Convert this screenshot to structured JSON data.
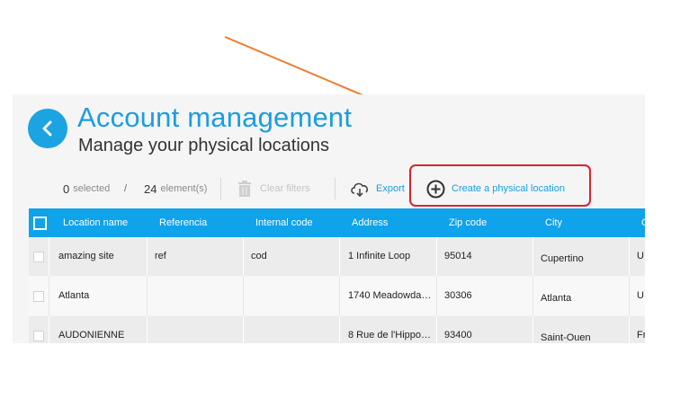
{
  "header": {
    "title": "Account management",
    "subtitle": "Manage your physical locations"
  },
  "toolbar": {
    "selected_count": "0",
    "selected_label": "selected",
    "divider": "/",
    "element_count": "24",
    "element_label": "element(s)",
    "clear_filters": "Clear filters",
    "export": "Export",
    "create": "Create a physical location"
  },
  "table": {
    "columns": [
      "Location name",
      "Referencia",
      "Internal code",
      "Address",
      "Zip code",
      "City",
      "C"
    ],
    "rows": [
      [
        "amazing site",
        "ref",
        "cod",
        "1 Infinite Loop",
        "95014",
        "Cupertino",
        "U"
      ],
      [
        "Atlanta",
        "",
        "",
        "1740 Meadowda…",
        "30306",
        "Atlanta",
        "U"
      ],
      [
        "AUDONIENNE",
        "",
        "",
        "8 Rue de l'Hippo…",
        "93400",
        "Saint-Ouen",
        "Fr"
      ]
    ]
  },
  "colors": {
    "accent": "#0ea3ea",
    "title": "#1b9ede",
    "highlight": "#d9232a",
    "arrow": "#ed7d31"
  }
}
